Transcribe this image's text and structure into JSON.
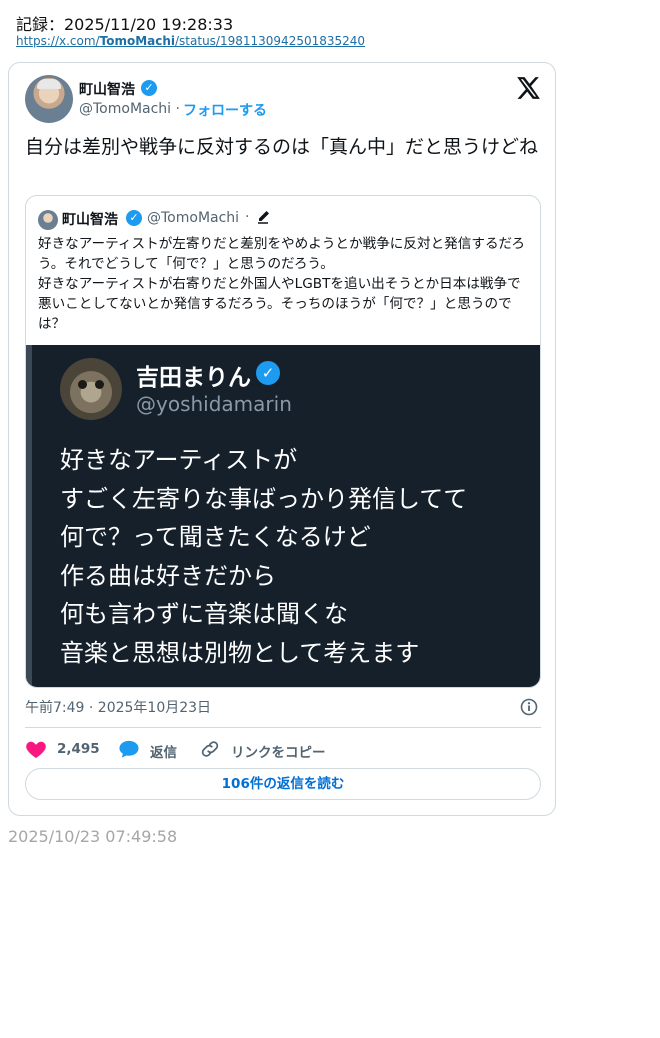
{
  "record": {
    "label": "記録：2025/11/20 19:28:33",
    "url_prefix": "https://x.com/",
    "url_user": "TomoMachi",
    "url_suffix": "/status/1981130942501835240"
  },
  "tweet": {
    "author_name": "町山智浩",
    "handle": "@TomoMachi",
    "separator": "·",
    "follow_label": "フォローする",
    "text": "自分は差別や戦争に反対するのは「真ん中」だと思うけどね",
    "timestamp": "午前7:49 · 2025年10月23日",
    "likes": "2,495",
    "reply_label": "返信",
    "copy_link_label": "リンクをコピー",
    "read_replies_label": "106件の返信を読む"
  },
  "quoted": {
    "author_name": "町山智浩",
    "handle": "@TomoMachi",
    "separator": "·",
    "text": "好きなアーティストが左寄りだと差別をやめようとか戦争に反対と発信するだろう。それでどうして「何で？」と思うのだろう。\n好きなアーティストが右寄りだと外国人やLGBTを追い出そうとか日本は戦争で悪いことしてないとか発信するだろう。そっちのほうが「何で？」と思うのでは？",
    "image": {
      "name": "吉田まりん",
      "handle": "@yoshidamarin",
      "lines": [
        "好きなアーティストが",
        "すごく左寄りな事ばっかり発信してて",
        "何で？って聞きたくなるけど",
        "作る曲は好きだから",
        "何も言わずに音楽は聞くな",
        "音楽と思想は別物として考えます"
      ]
    }
  },
  "footer": {
    "date": "2025/10/23 07:49:58"
  },
  "colors": {
    "accent": "#1d9bf0",
    "like": "#f91880",
    "text": "#0f1419",
    "muted": "#536471",
    "border": "#cfd9de",
    "image_bg": "#15202b"
  }
}
